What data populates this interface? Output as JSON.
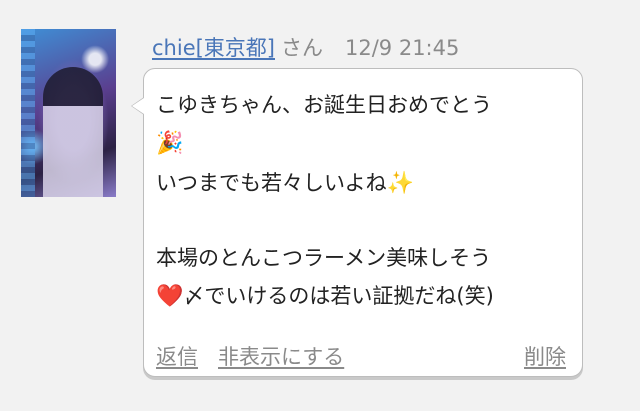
{
  "comment": {
    "username": "chie[東京都]",
    "honorific": "さん",
    "timestamp": "12/9 21:45",
    "lines": [
      "こゆきちゃん、お誕生日おめでとう",
      "いつまでも若々しいよね",
      "本場のとんこつラーメン美味しそう",
      "〆でいけるのは若い証拠だね(笑)"
    ],
    "emojis": {
      "party": "🎉",
      "sparkles": "✨",
      "heart": "❤️"
    },
    "actions": {
      "reply": "返信",
      "hide": "非表示にする",
      "delete": "削除"
    }
  }
}
